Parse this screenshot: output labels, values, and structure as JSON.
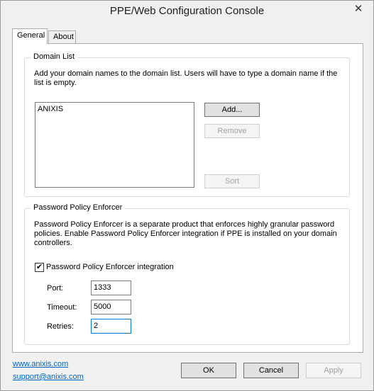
{
  "window": {
    "title": "PPE/Web Configuration Console",
    "close_glyph": "✕"
  },
  "tabs": [
    {
      "label": "General",
      "active": true
    },
    {
      "label": "About",
      "active": false
    }
  ],
  "domain_list": {
    "group_title": "Domain List",
    "description": "Add your domain names to the domain list. Users will have to type a domain name if the list is empty.",
    "items": [
      "ANIXIS"
    ],
    "buttons": {
      "add": "Add...",
      "remove": "Remove",
      "sort": "Sort"
    }
  },
  "ppe": {
    "group_title": "Password Policy Enforcer",
    "description": "Password Policy Enforcer is a separate product that enforces highly granular password policies. Enable Password Policy Enforcer integration if PPE is installed on your domain controllers.",
    "checkbox_label": "Password Policy Enforcer integration",
    "checkbox_checked": true,
    "check_glyph": "✔",
    "port_label": "Port:",
    "port_value": "1333",
    "timeout_label": "Timeout:",
    "timeout_value": "5000",
    "retries_label": "Retries:",
    "retries_value": "2"
  },
  "footer": {
    "link_website": "www.anixis.com",
    "link_support": "support@anixis.com",
    "ok": "OK",
    "cancel": "Cancel",
    "apply": "Apply"
  }
}
